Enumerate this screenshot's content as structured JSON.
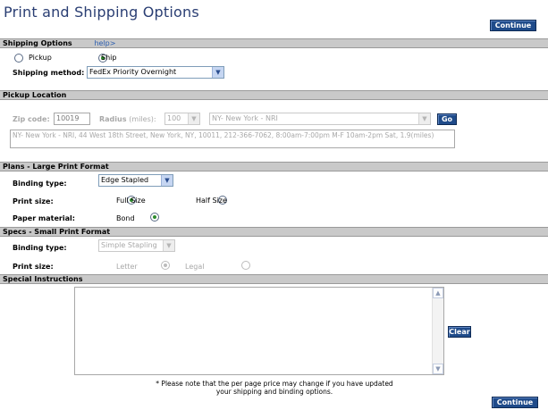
{
  "page": {
    "title": "Print and Shipping Options",
    "continue_label": "Continue"
  },
  "shipping": {
    "header": "Shipping Options",
    "help": "help>",
    "pickup_label": "Pickup",
    "ship_label": "Ship",
    "method_label": "Shipping method:",
    "method_value": "FedEx Priority Overnight"
  },
  "pickup": {
    "header": "Pickup Location",
    "zip_label": "Zip code:",
    "zip_value": "10019",
    "radius_label": "Radius",
    "radius_unit": "(miles):",
    "radius_value": "100",
    "location_value": "NY- New York - NRI",
    "go_label": "Go",
    "address_text": "NY- New York - NRI, 44 West 18th Street, New York, NY, 10011, 212-366-7062, 8:00am-7:00pm M-F 10am-2pm Sat, 1.9(miles)"
  },
  "plans": {
    "header": "Plans - Large Print Format",
    "binding_label": "Binding type:",
    "binding_value": "Edge Stapled",
    "size_label": "Print size:",
    "full_label": "Full Size",
    "half_label": "Half Size",
    "paper_label": "Paper material:",
    "bond_label": "Bond"
  },
  "specs": {
    "header": "Specs - Small Print Format",
    "binding_label": "Binding type:",
    "binding_value": "Simple Stapling",
    "size_label": "Print size:",
    "letter_label": "Letter",
    "legal_label": "Legal"
  },
  "special": {
    "header": "Special Instructions",
    "clear_label": "Clear",
    "note_line1": "* Please note that the per page price may change if you have updated",
    "note_line2": "your shipping and binding options."
  }
}
